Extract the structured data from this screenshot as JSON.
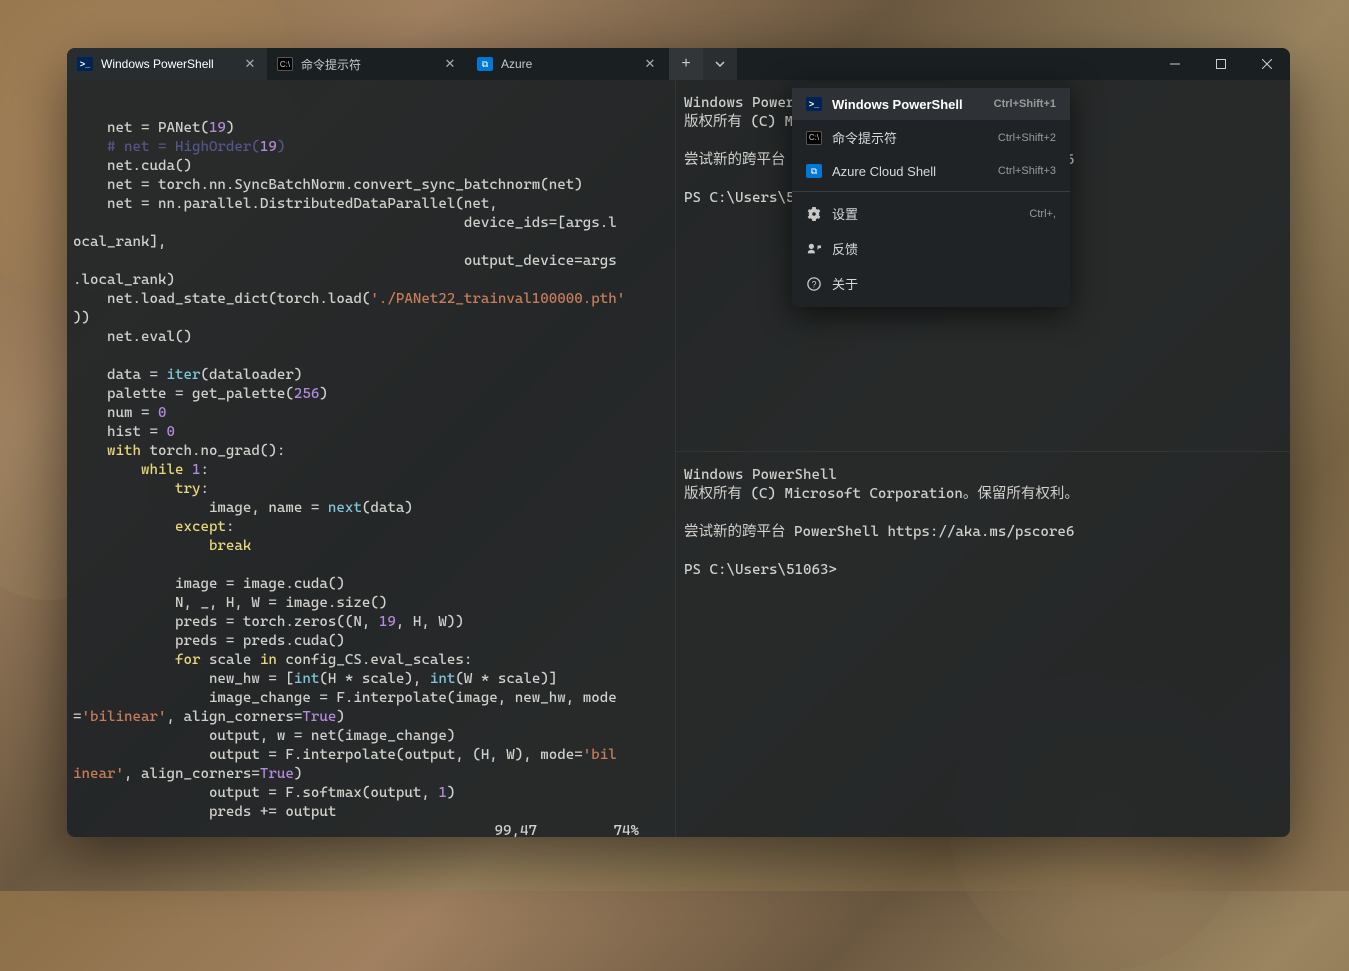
{
  "tabs": [
    {
      "label": "Windows PowerShell",
      "icon": "ps"
    },
    {
      "label": "命令提示符",
      "icon": "cmd"
    },
    {
      "label": "Azure",
      "icon": "az"
    }
  ],
  "dropdown": {
    "items": [
      {
        "label": "Windows PowerShell",
        "shortcut": "Ctrl+Shift+1",
        "icon": "ps"
      },
      {
        "label": "命令提示符",
        "shortcut": "Ctrl+Shift+2",
        "icon": "cmd"
      },
      {
        "label": "Azure Cloud Shell",
        "shortcut": "Ctrl+Shift+3",
        "icon": "az"
      }
    ],
    "settings": {
      "label": "设置",
      "shortcut": "Ctrl+,"
    },
    "feedback": {
      "label": "反馈"
    },
    "about": {
      "label": "关于"
    }
  },
  "pane_right": {
    "line1": "Windows PowerShell",
    "line2": "版权所有 (C) Microsoft Corporation。保留所有权利。",
    "line3": "尝试新的跨平台 PowerShell https://aka.ms/pscore6",
    "prompt": "PS C:\\Users\\51063>"
  },
  "code": {
    "status_pos": "99,47",
    "status_pct": "74%",
    "values": {
      "panet_arg": "19",
      "highorder_arg": "19",
      "path": "'./PANet22_trainval100000.pth'",
      "palette_arg": "256",
      "num_init": "0",
      "hist_init": "0",
      "while_cond": "1",
      "zeros_arg": "19",
      "bilinear1": "'bilinear'",
      "bilinear2": "'bilinear'",
      "bil_suffix": "'bilinear'",
      "true1": "True",
      "true2": "True",
      "softmax_dim": "1"
    }
  }
}
